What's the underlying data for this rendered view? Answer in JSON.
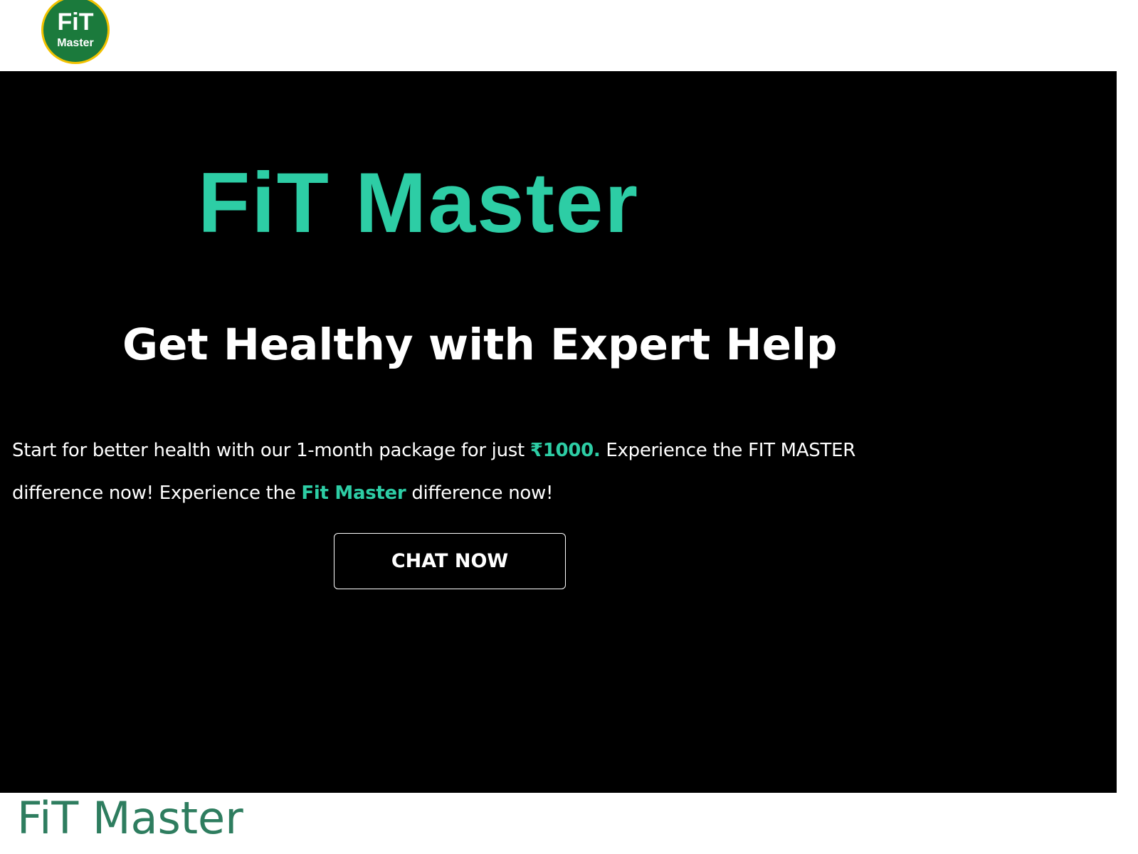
{
  "header": {
    "logo": {
      "icon": "fit-master-logo-icon",
      "text_top": "FiT",
      "text_bottom": "Master"
    }
  },
  "hero": {
    "title": "FiT Master",
    "subtitle": "Get Healthy with Expert Help",
    "description": {
      "part1": "Start for better health with our 1-month package for just ",
      "price": "₹1000.",
      "part2": " Experience the FIT MASTER difference now! Experience the ",
      "brand": "Fit Master",
      "part3": " difference now!"
    },
    "cta_label": "CHAT NOW"
  },
  "footer": {
    "brand": "FiT Master"
  },
  "colors": {
    "accent": "#2dcda5",
    "hero_background": "#000000",
    "logo_green": "#1b7a3c",
    "logo_ring": "#f2c200",
    "footer_brand": "#2e7d5f"
  }
}
